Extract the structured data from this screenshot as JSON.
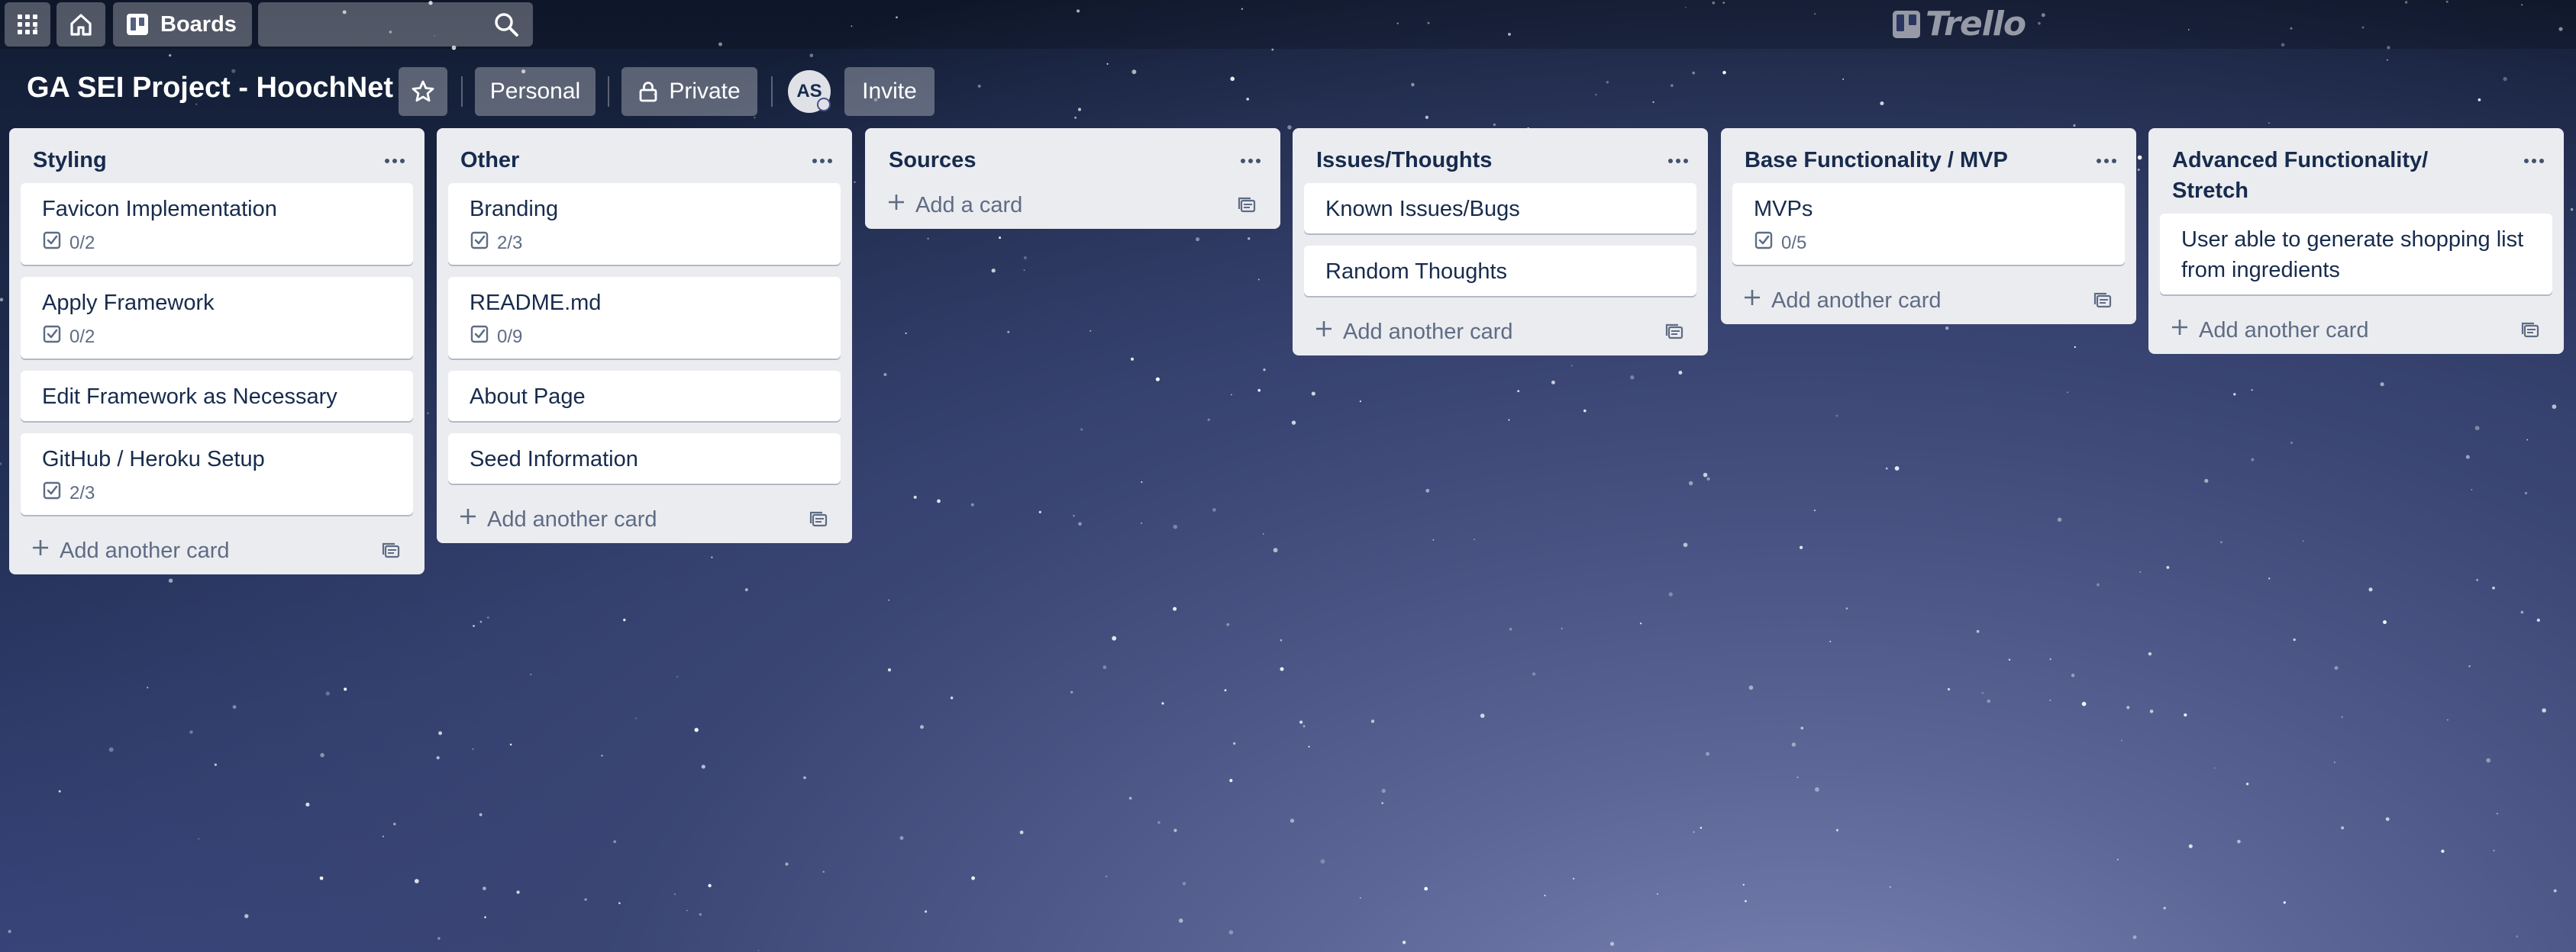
{
  "topbar": {
    "apps_icon": "grid-icon",
    "home_icon": "home-icon",
    "boards_label": "Boards",
    "search_placeholder": "",
    "logo_text": "Trello"
  },
  "board": {
    "title": "GA SEI Project - HoochNet",
    "workspace_label": "Personal",
    "visibility_label": "Private",
    "member_initials": "AS",
    "invite_label": "Invite"
  },
  "lists": [
    {
      "title": "Styling",
      "cards": [
        {
          "title": "Favicon Implementation",
          "checklist": "0/2"
        },
        {
          "title": "Apply Framework",
          "checklist": "0/2"
        },
        {
          "title": "Edit Framework as Necessary"
        },
        {
          "title": "GitHub / Heroku Setup",
          "checklist": "2/3"
        }
      ],
      "add_label": "Add another card"
    },
    {
      "title": "Other",
      "cards": [
        {
          "title": "Branding",
          "checklist": "2/3"
        },
        {
          "title": "README.md",
          "checklist": "0/9"
        },
        {
          "title": "About Page"
        },
        {
          "title": "Seed Information"
        }
      ],
      "add_label": "Add another card"
    },
    {
      "title": "Sources",
      "cards": [],
      "add_label": "Add a card"
    },
    {
      "title": "Issues/Thoughts",
      "cards": [
        {
          "title": "Known Issues/Bugs"
        },
        {
          "title": "Random Thoughts"
        }
      ],
      "add_label": "Add another card"
    },
    {
      "title": "Base Functionality / MVP",
      "cards": [
        {
          "title": "MVPs",
          "checklist": "0/5"
        }
      ],
      "add_label": "Add another card"
    },
    {
      "title": "Advanced Functionality/ Stretch",
      "cards": [
        {
          "title": "User able to generate shopping list from ingredients"
        }
      ],
      "add_label": "Add another card"
    }
  ]
}
